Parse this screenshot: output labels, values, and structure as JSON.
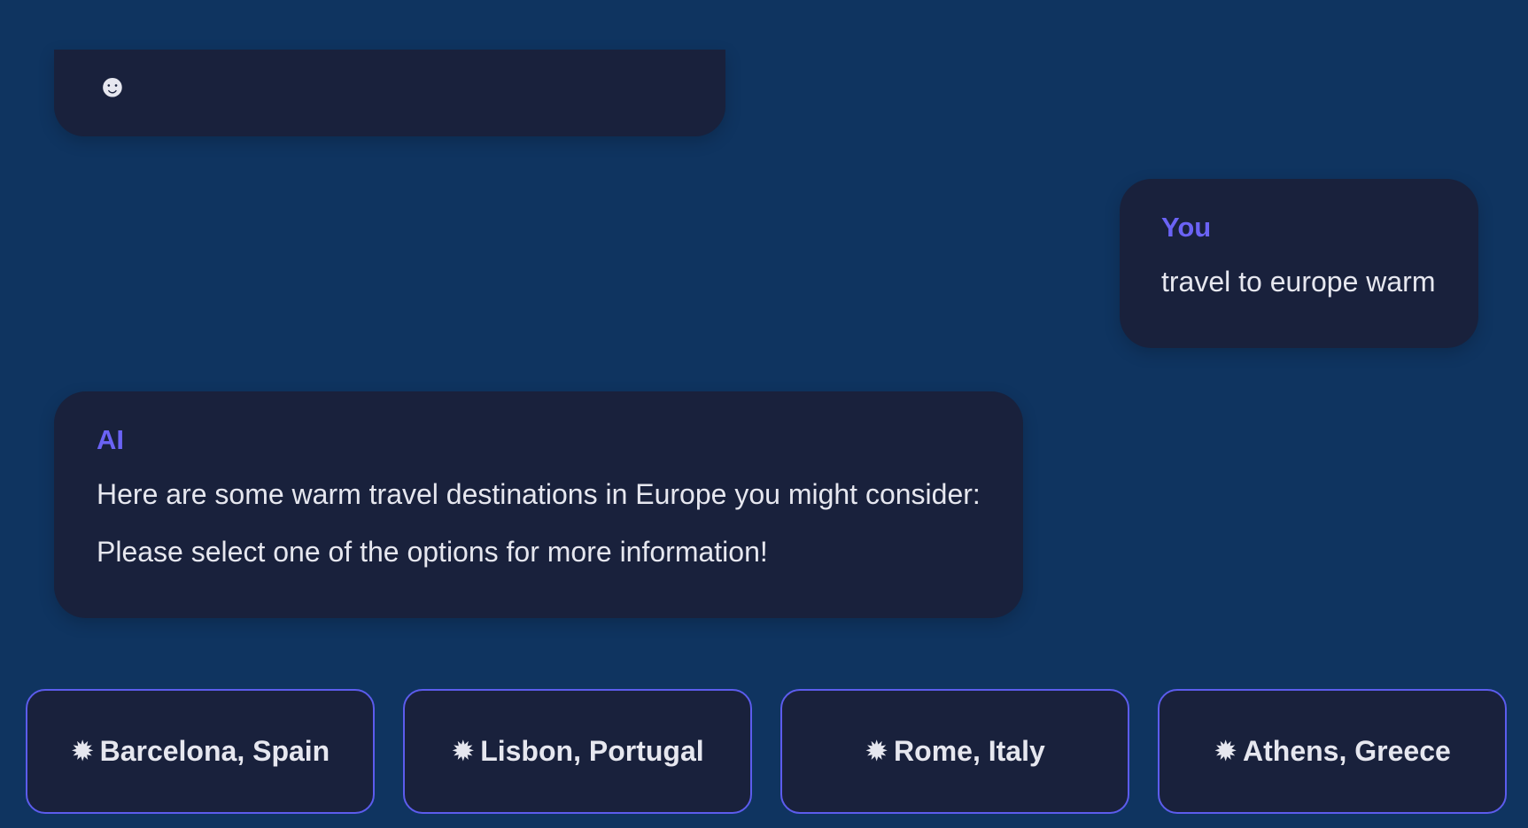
{
  "chat": {
    "top_bubble": {
      "emoji": "☻"
    },
    "user_message": {
      "sender": "You",
      "text": "travel to europe warm"
    },
    "ai_message": {
      "sender": "AI",
      "lines": [
        "Here are some warm travel destinations in Europe you might consider:",
        "Please select one of the options for more information!"
      ]
    }
  },
  "options": [
    {
      "icon": "✹",
      "label": "Barcelona, Spain"
    },
    {
      "icon": "✹",
      "label": "Lisbon, Portugal"
    },
    {
      "icon": "✹",
      "label": "Rome, Italy"
    },
    {
      "icon": "✹",
      "label": "Athens, Greece"
    }
  ],
  "colors": {
    "background": "#0f3460",
    "bubble": "#19213c",
    "accent": "#6b63f5",
    "option_border": "#5c5ced",
    "text": "#e6e7ef"
  }
}
